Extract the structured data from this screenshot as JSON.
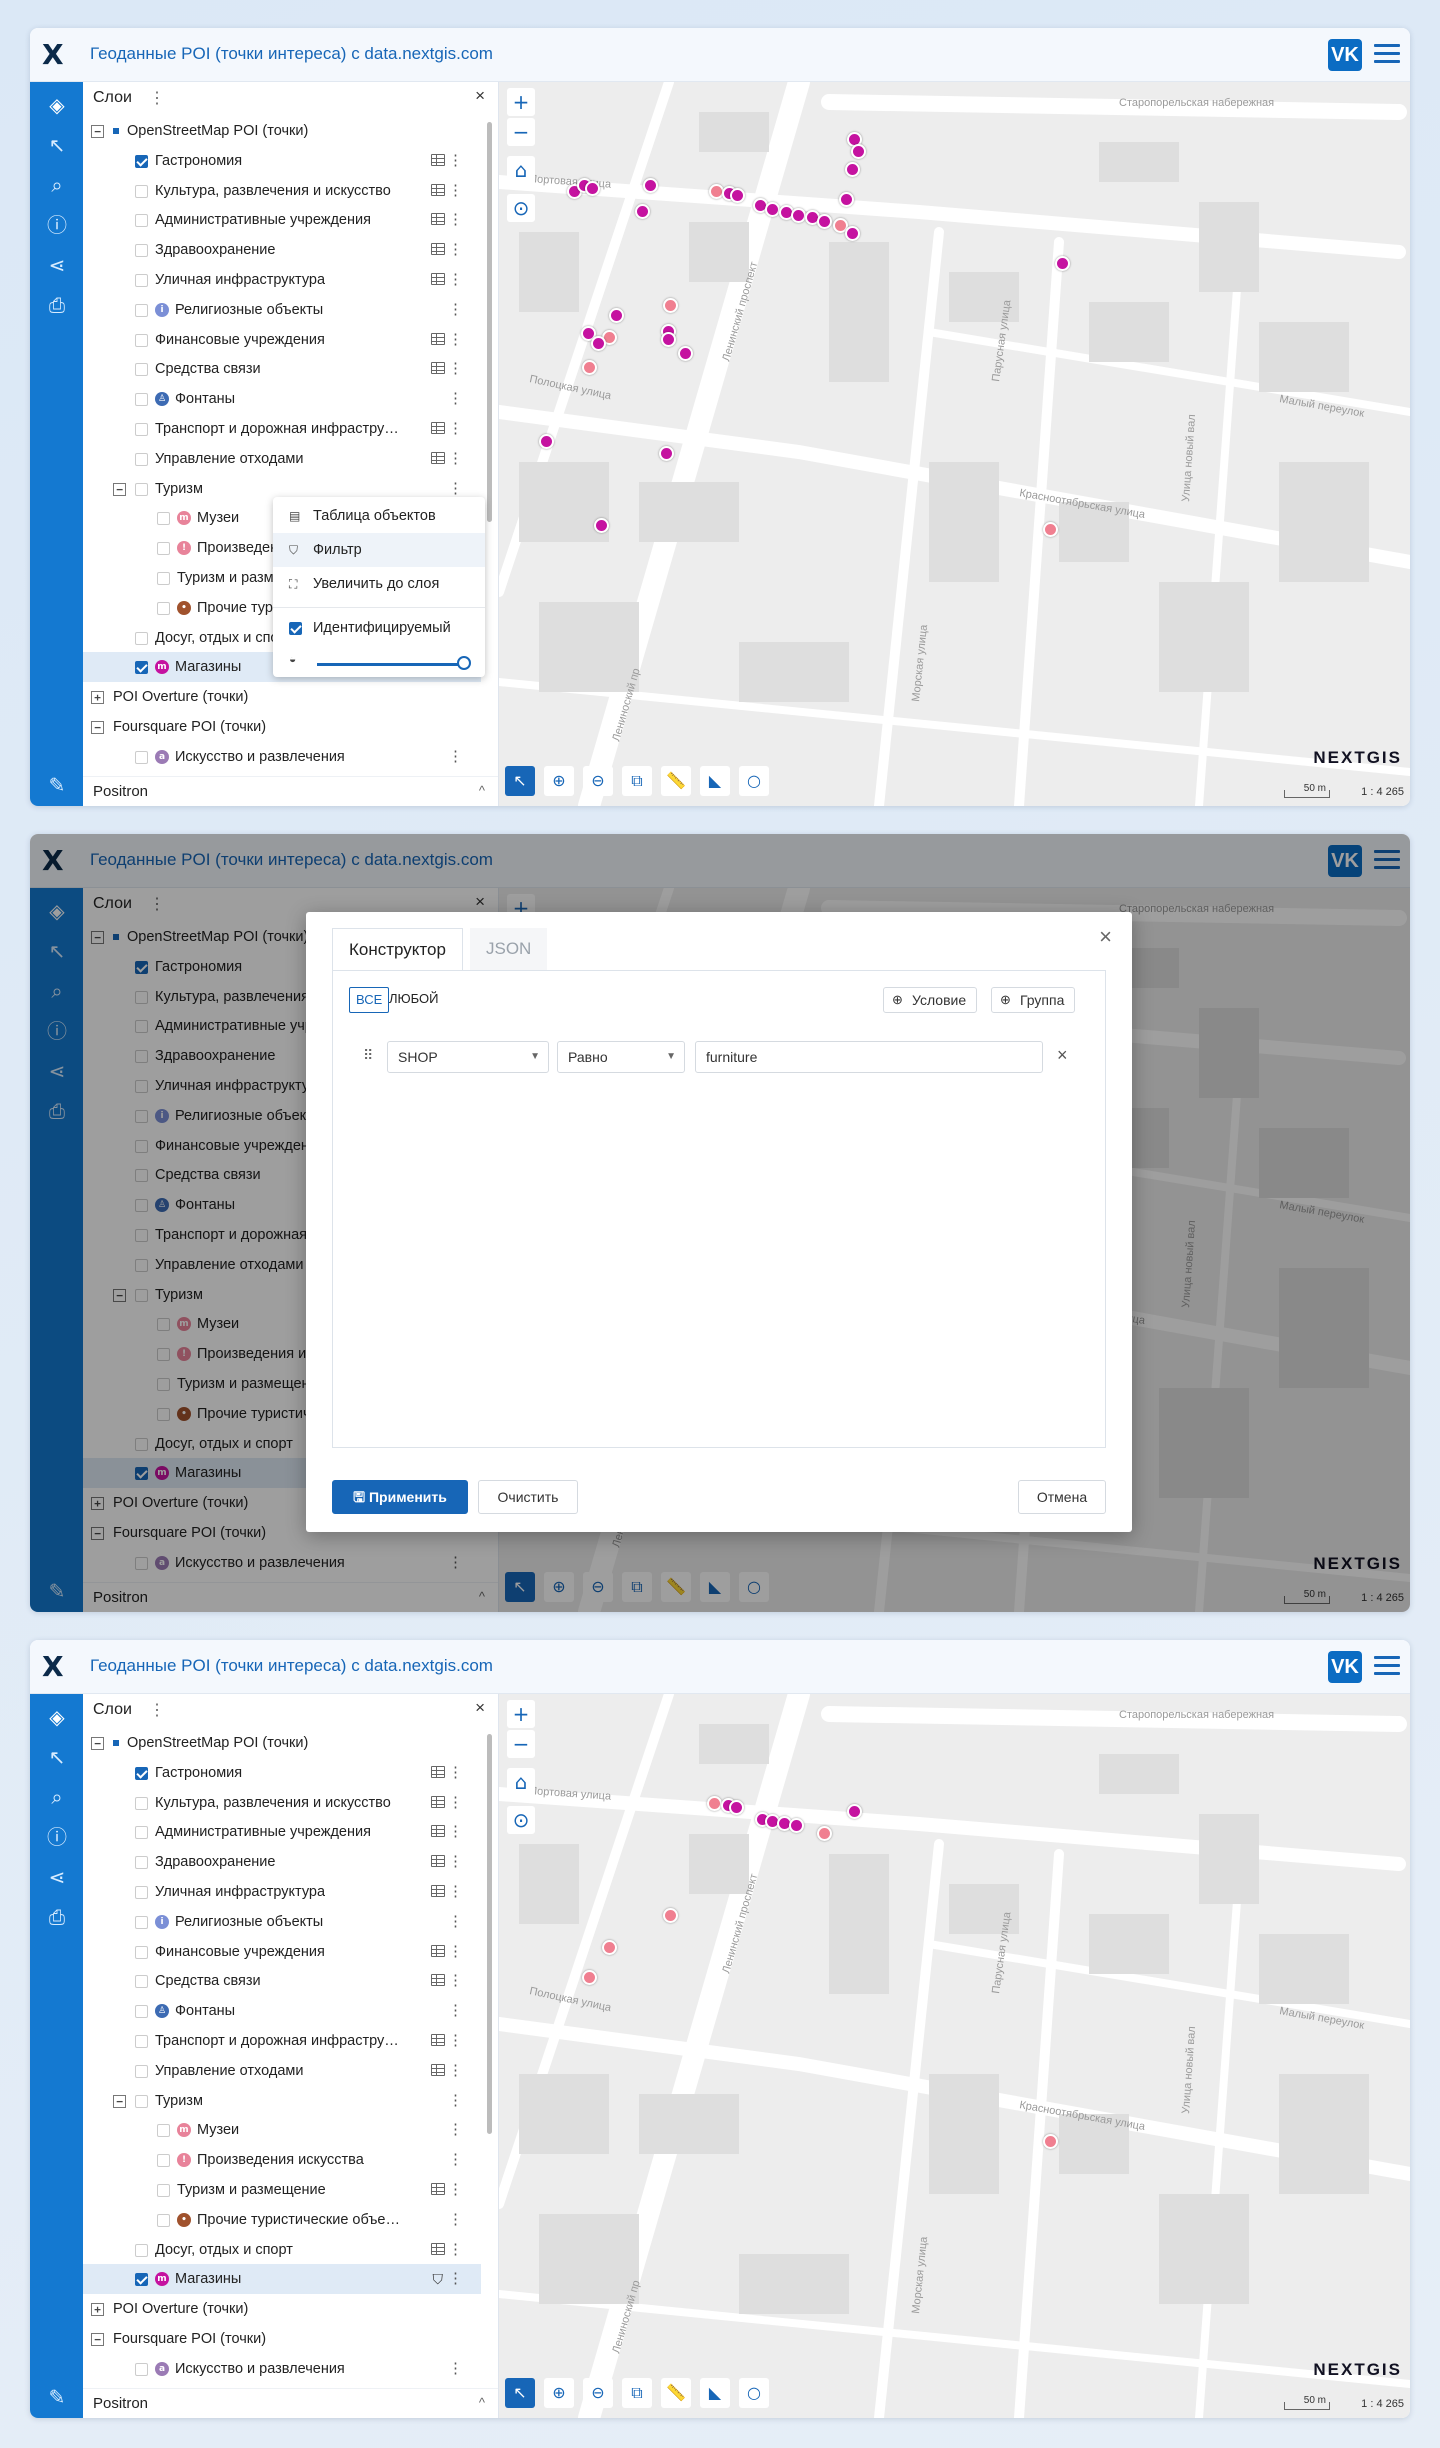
{
  "app": {
    "logo": "X",
    "title": "Геоданные POI (точки интереса) с data.nextgis.com",
    "vk": "VK"
  },
  "toolbar": {
    "layers": "◈",
    "select": "↖",
    "search": "⌕",
    "info": "ⓘ",
    "share": "⋖",
    "print": "⎙",
    "edit": "✎"
  },
  "panel": {
    "title": "Слои",
    "dots": "⋮",
    "close": "×",
    "footer": "Positron",
    "footer_caret": "^"
  },
  "tree": [
    {
      "label": "OpenStreetMap POI (точки)",
      "indent": 0,
      "toggle": "−",
      "check": "square",
      "table": false
    },
    {
      "label": "Гастрономия",
      "indent": 1,
      "check": "on",
      "table": true
    },
    {
      "label": "Культура, развлечения и искусство",
      "indent": 1,
      "check": "off",
      "table": true
    },
    {
      "label": "Административные учреждения",
      "indent": 1,
      "check": "off",
      "table": true
    },
    {
      "label": "Здравоохранение",
      "indent": 1,
      "check": "off",
      "table": true
    },
    {
      "label": "Уличная инфраструктура",
      "indent": 1,
      "check": "off",
      "table": true
    },
    {
      "label": "Религиозные объекты",
      "indent": 1,
      "check": "off",
      "icon": "i",
      "icolor": "#7b8fd6",
      "table": false
    },
    {
      "label": "Финансовые учреждения",
      "indent": 1,
      "check": "off",
      "table": true
    },
    {
      "label": "Средства связи",
      "indent": 1,
      "check": "off",
      "table": true
    },
    {
      "label": "Фонтаны",
      "indent": 1,
      "check": "off",
      "icon": "♙",
      "icolor": "#3d6bb3",
      "table": false
    },
    {
      "label": "Транспорт и дорожная инфраструктура",
      "indent": 1,
      "check": "off",
      "table": true
    },
    {
      "label": "Управление отходами",
      "indent": 1,
      "check": "off",
      "table": true
    },
    {
      "label": "Туризм",
      "indent": 1,
      "toggle": "−",
      "check": "off",
      "table": false
    },
    {
      "label": "Музеи",
      "indent": 2,
      "check": "off",
      "icon": "m",
      "icolor": "#e8839a",
      "table": false
    },
    {
      "label": "Произведения искусства",
      "indent": 2,
      "check": "off",
      "icon": "!",
      "icolor": "#e8839a",
      "table": false
    },
    {
      "label": "Туризм и размещение",
      "indent": 2,
      "check": "off",
      "table": true
    },
    {
      "label": "Прочие туристические объекты",
      "indent": 2,
      "check": "off",
      "icon": "•",
      "icolor": "#a0522d",
      "table": false
    },
    {
      "label": "Досуг, отдых и спорт",
      "indent": 1,
      "check": "off",
      "table": true
    },
    {
      "label": "Магазины",
      "indent": 1,
      "check": "on",
      "icon": "m",
      "icolor": "#c512a0",
      "table": false,
      "selected": true
    },
    {
      "label": "POI Overture (точки)",
      "indent": 0,
      "toggle": "+",
      "check": "none",
      "table": false
    },
    {
      "label": "Foursquare POI (точки)",
      "indent": 0,
      "toggle": "−",
      "check": "none",
      "table": false
    },
    {
      "label": "Искусство и развлечения",
      "indent": 1,
      "check": "off",
      "icon": "a",
      "icolor": "#9b7bb5",
      "table": false
    }
  ],
  "context_menu": {
    "table": "Таблица объектов",
    "filter": "Фильтр",
    "zoom": "Увеличить до слоя",
    "identify": "Идентифицируемый"
  },
  "map": {
    "zoom_in": "+",
    "zoom_out": "−",
    "home": "⌂",
    "locate": "⊙",
    "brand": "NEXTGIS",
    "scale": "50 m",
    "ratio": "1 : 4 265",
    "streets": [
      "Портовая улица",
      "Старопорельская набережная",
      "Ленинский проспект",
      "Парусная улица",
      "Полоцкая улица",
      "Красноотябрьская улица",
      "Малый переулок",
      "Морская улица",
      "Лениноский пр",
      "Улица новый вал"
    ],
    "tools": [
      "↖",
      "⊕",
      "⊖",
      "⧉",
      "📏",
      "◣",
      "○"
    ]
  },
  "filter": {
    "tab_constructor": "Конструктор",
    "tab_json": "JSON",
    "all": "ВСЕ",
    "any": "ЛЮБОЙ",
    "add_condition": "Условие",
    "add_group": "Группа",
    "field": "SHOP",
    "operator": "Равно",
    "value": "furniture",
    "apply": "Применить",
    "clear": "Очистить",
    "cancel": "Отмена"
  },
  "poi_color": "#c512a0",
  "accent": "#1766b7"
}
